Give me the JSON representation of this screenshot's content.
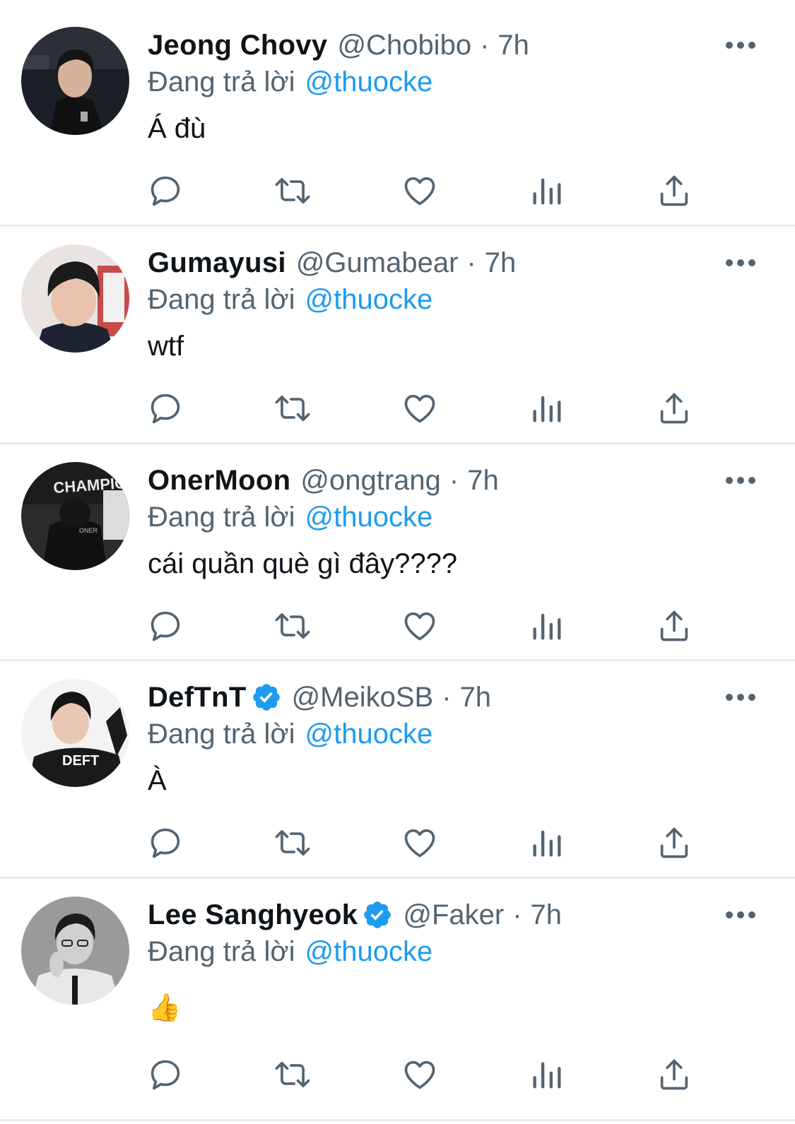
{
  "colors": {
    "text": "#0f1419",
    "secondary": "#536471",
    "link": "#1d9bf0",
    "divider": "#e9ecee",
    "verified": "#1d9bf0"
  },
  "action_icons": [
    "reply-icon",
    "retweet-icon",
    "like-icon",
    "analytics-icon",
    "share-icon"
  ],
  "tweets": [
    {
      "name": "Jeong Chovy",
      "verified": false,
      "handle": "@Chobibo",
      "separator": "·",
      "time": "7h",
      "reply_label": "Đang trả lời",
      "reply_to": "@thuocke",
      "text": "Á đù"
    },
    {
      "name": "Gumayusi",
      "verified": false,
      "handle": "@Gumabear",
      "separator": "·",
      "time": "7h",
      "reply_label": "Đang trả lời",
      "reply_to": "@thuocke",
      "text": "wtf"
    },
    {
      "name": "OnerMoon",
      "verified": false,
      "handle": "@ongtrang",
      "separator": "·",
      "time": "7h",
      "reply_label": "Đang trả lời",
      "reply_to": "@thuocke",
      "text": "cái quần què gì đây????",
      "avatar_text": [
        "CHAMPION",
        "ONER"
      ]
    },
    {
      "name": "DefTnT",
      "verified": true,
      "handle": "@MeikoSB",
      "separator": "·",
      "time": "7h",
      "reply_label": "Đang trả lời",
      "reply_to": "@thuocke",
      "text": "À",
      "avatar_text": [
        "DEFT"
      ]
    },
    {
      "name": "Lee Sanghyeok",
      "verified": true,
      "handle": "@Faker",
      "separator": "·",
      "time": "7h",
      "reply_label": "Đang trả lời",
      "reply_to": "@thuocke",
      "text": "👍"
    }
  ]
}
